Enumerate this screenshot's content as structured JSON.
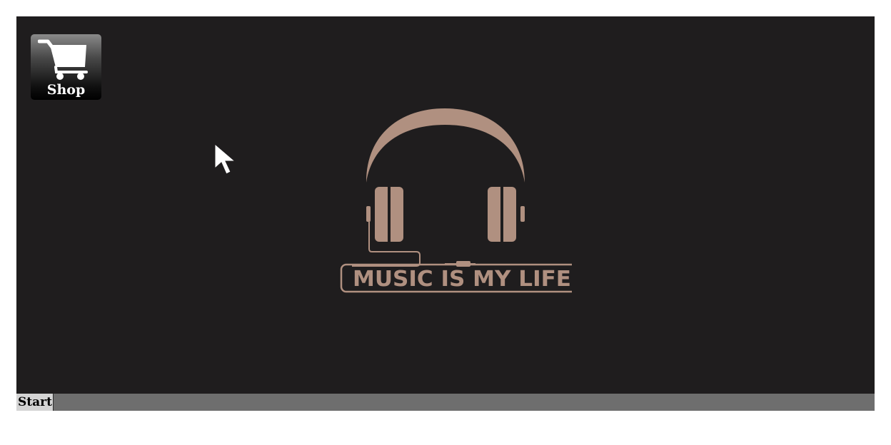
{
  "desktop": {
    "icons": [
      {
        "label": "Shop",
        "icon": "shopping-cart-icon"
      }
    ],
    "wallpaper": {
      "text": "MUSIC IS MY LIFE",
      "icon": "headphones-icon",
      "color": "#b09080",
      "background": "#1f1d1e"
    }
  },
  "taskbar": {
    "start_label": "Start",
    "color": "#6e6e6e"
  },
  "cursor": {
    "icon": "arrow-cursor-icon"
  }
}
